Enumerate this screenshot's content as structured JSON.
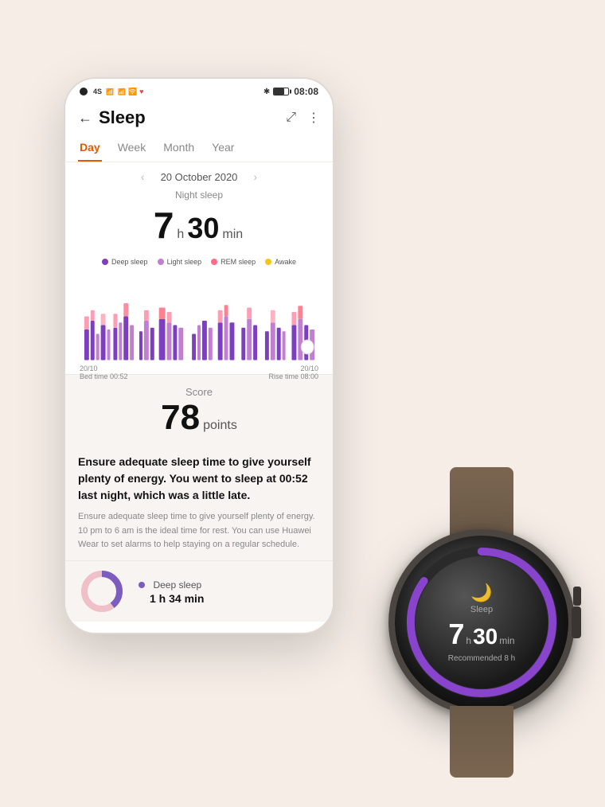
{
  "status": {
    "time": "08:08",
    "signal": "4G",
    "wifi": "WiFi",
    "battery": "70"
  },
  "header": {
    "title": "Sleep",
    "back_label": "←",
    "share_icon": "share",
    "more_icon": "⋮"
  },
  "tabs": {
    "items": [
      {
        "label": "Day",
        "active": true
      },
      {
        "label": "Week",
        "active": false
      },
      {
        "label": "Month",
        "active": false
      },
      {
        "label": "Year",
        "active": false
      }
    ]
  },
  "date": {
    "text": "20 October 2020",
    "prev_arrow": "‹",
    "next_arrow": "›"
  },
  "sleep": {
    "label": "Night sleep",
    "hours": "7",
    "h_unit": "h",
    "minutes": "30",
    "min_unit": "min"
  },
  "legend": [
    {
      "label": "Deep sleep",
      "color": "#7c3fbf"
    },
    {
      "label": "Light sleep",
      "color": "#c07fd0"
    },
    {
      "label": "REM sleep",
      "color": "#ff6b8a"
    },
    {
      "label": "Awake",
      "color": "#f5c518"
    }
  ],
  "chart": {
    "left_label": "20/10\nBed time 00:52",
    "right_label": "20/10\nRise time 08:00"
  },
  "score": {
    "label": "Score",
    "value": "78",
    "unit": "points"
  },
  "advice": {
    "highlight": "Ensure adequate sleep time to give yourself plenty of energy. You went to sleep at 00:52 last night, which was a little late.",
    "detail": "Ensure adequate sleep time to give yourself plenty of energy. 10 pm to 6 am is the ideal time for rest. You can use Huawei Wear to set alarms to help staying on a regular schedule."
  },
  "deep_sleep": {
    "label": "Deep sleep",
    "duration": "1 h 34 min",
    "color": "#7c5cbf"
  },
  "watch": {
    "moon": "🌙",
    "sleep_label": "Sleep",
    "hours": "7",
    "h_unit": "h",
    "minutes": "30",
    "min_unit": "min",
    "recommended_label": "Recommended",
    "recommended_hours": "8 h"
  }
}
